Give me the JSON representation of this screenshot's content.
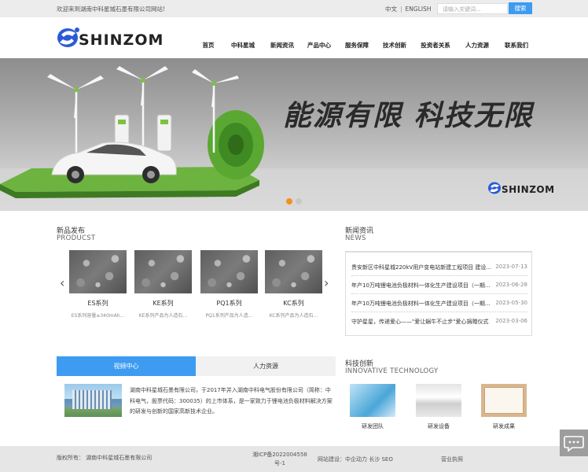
{
  "topbar": {
    "welcome": "欢迎来到湖南中科星城石墨有限公司网站!",
    "lang_zh": "中文",
    "lang_en": "ENGLISH",
    "search_placeholder": "请输入关键词...",
    "search_button": "搜索"
  },
  "header": {
    "logo_text": "SHINZOM",
    "nav": [
      "首页",
      "中科星城",
      "新闻资讯",
      "产品中心",
      "服务保障",
      "技术创新",
      "投资者关系",
      "人力资源",
      "联系我们"
    ]
  },
  "banner": {
    "slogan": "能源有限 科技无限",
    "logo_text": "SHINZOM",
    "slides": 2,
    "active_slide": 1
  },
  "products": {
    "title": "新品发布",
    "subtitle": "PRODUCST",
    "items": [
      {
        "name": "ES系列",
        "desc": "ES系列容量≥340mAh..."
      },
      {
        "name": "KE系列",
        "desc": "KE系列产品为人造石..."
      },
      {
        "name": "PQ1系列",
        "desc": "PQ1系列产品为人造..."
      },
      {
        "name": "KC系列",
        "desc": "KC系列产品为人造石..."
      }
    ]
  },
  "news": {
    "title": "新闻资讯",
    "subtitle": "NEWS",
    "items": [
      {
        "title": "贵安新区中科星城220kV用户变电站新建工程项目 建设...",
        "date": "2023-07-13"
      },
      {
        "title": "年产10万吨锂电池负极材料一体化生产建设项目（一期...",
        "date": "2023-06-28"
      },
      {
        "title": "年产10万吨锂电池负极材料一体化生产建设项目（一期...",
        "date": "2023-05-30"
      },
      {
        "title": "守护星星，传递爱心——\"爱让蜗牛不止步\"爱心捐赠仪式",
        "date": "2023-03-06"
      }
    ]
  },
  "media": {
    "tab_video": "视频中心",
    "tab_hr": "人力资源",
    "company_text": "湖南中科星城石墨有限公司，于2017年并入湖南中科电气股份有限公司（简称：中科电气，股票代码：300035）的上市体系，是一家致力于锂电池负极材料解决方案的研发与创新的国家高新技术企业。"
  },
  "innovation": {
    "title": "科技创新",
    "subtitle": "INNOVATIVE TECHNOLOGY",
    "items": [
      "研发团队",
      "研发设备",
      "研发成果"
    ]
  },
  "footer": {
    "copyright": "版权所有：  湖南中科星城石墨有限公司",
    "icp": "湘ICP备2022004558号-1",
    "site_build": "网站建设：中企动力   长沙   SEO",
    "license": "营业执照"
  },
  "colors": {
    "accent": "#3d9bf2",
    "slide_active": "#f29222",
    "logo_blue": "#2a5bd7"
  }
}
